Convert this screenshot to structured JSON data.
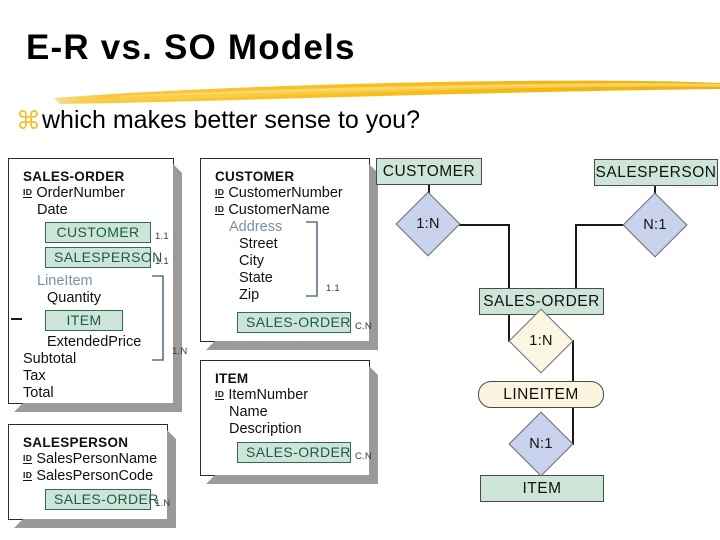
{
  "slide": {
    "title": "E-R vs. SO Models",
    "bullet_glyph": "⌘",
    "bullet_text": "which makes better sense to you?",
    "accent_color": "#F2C230",
    "object_box_fill": "#CDE5D8",
    "object_box_border": "#2F6B53",
    "diamond_fill": "#C8D2EC",
    "lineitem_fill": "#FBF5DF"
  },
  "so_model": {
    "cards": [
      {
        "name": "SALES-ORDER",
        "rows": [
          {
            "kind": "attr",
            "id": true,
            "label": "OrderNumber"
          },
          {
            "kind": "attr",
            "id": false,
            "label": "Date"
          },
          {
            "kind": "objbox",
            "label": "CUSTOMER",
            "cardinality": "1.1"
          },
          {
            "kind": "objbox",
            "label": "SALESPERSON",
            "cardinality": "1.1"
          },
          {
            "kind": "group",
            "label": "LineItem",
            "cardinality": "1.N"
          },
          {
            "kind": "attr",
            "id": false,
            "label": "Quantity"
          },
          {
            "kind": "objbox",
            "label": "ITEM",
            "cardinality": ""
          },
          {
            "kind": "attr",
            "id": false,
            "label": "ExtendedPrice"
          },
          {
            "kind": "attr",
            "id": false,
            "label": "Subtotal"
          },
          {
            "kind": "attr",
            "id": false,
            "label": "Tax"
          },
          {
            "kind": "attr",
            "id": false,
            "label": "Total"
          }
        ]
      },
      {
        "name": "SALESPERSON",
        "rows": [
          {
            "kind": "attr",
            "id": true,
            "label": "SalesPersonName"
          },
          {
            "kind": "attr",
            "id": true,
            "label": "SalesPersonCode"
          },
          {
            "kind": "objbox",
            "label": "SALES-ORDER",
            "cardinality": "1.N"
          }
        ]
      },
      {
        "name": "CUSTOMER",
        "rows": [
          {
            "kind": "attr",
            "id": true,
            "label": "CustomerNumber"
          },
          {
            "kind": "attr",
            "id": true,
            "label": "CustomerName"
          },
          {
            "kind": "group",
            "label": "Address",
            "cardinality": "1.1"
          },
          {
            "kind": "attr",
            "id": false,
            "label": "Street"
          },
          {
            "kind": "attr",
            "id": false,
            "label": "City"
          },
          {
            "kind": "attr",
            "id": false,
            "label": "State"
          },
          {
            "kind": "attr",
            "id": false,
            "label": "Zip"
          },
          {
            "kind": "objbox",
            "label": "SALES-ORDER",
            "cardinality": "C.N"
          }
        ]
      },
      {
        "name": "ITEM",
        "rows": [
          {
            "kind": "attr",
            "id": true,
            "label": "ItemNumber"
          },
          {
            "kind": "attr",
            "id": false,
            "label": "Name"
          },
          {
            "kind": "attr",
            "id": false,
            "label": "Description"
          },
          {
            "kind": "objbox",
            "label": "SALES-ORDER",
            "cardinality": "C.N"
          }
        ]
      }
    ],
    "labels": {
      "card_so_customer": "1.1",
      "card_so_salesperson": "1.1",
      "card_so_lineitem": "1.N",
      "card_sp_salesorder": "1.N",
      "card_cu_address": "1.1",
      "card_cu_salesorder": "C.N",
      "card_it_salesorder": "C.N",
      "so_title": "SALES-ORDER",
      "so_attr_ordernumber": "OrderNumber",
      "so_attr_date": "Date",
      "so_obj_customer": "CUSTOMER",
      "so_obj_salesperson": "SALESPERSON",
      "so_group_lineitem": "LineItem",
      "so_attr_quantity": "Quantity",
      "so_obj_item": "ITEM",
      "so_attr_extendedprice": "ExtendedPrice",
      "so_attr_subtotal": "Subtotal",
      "so_attr_tax": "Tax",
      "so_attr_total": "Total",
      "sp_title": "SALESPERSON",
      "sp_attr_name": "SalesPersonName",
      "sp_attr_code": "SalesPersonCode",
      "sp_obj_salesorder": "SALES-ORDER",
      "cu_title": "CUSTOMER",
      "cu_attr_number": "CustomerNumber",
      "cu_attr_name": "CustomerName",
      "cu_group_address": "Address",
      "cu_attr_street": "Street",
      "cu_attr_city": "City",
      "cu_attr_state": "State",
      "cu_attr_zip": "Zip",
      "cu_obj_salesorder": "SALES-ORDER",
      "it_title": "ITEM",
      "it_attr_number": "ItemNumber",
      "it_attr_name": "Name",
      "it_attr_description": "Description",
      "it_obj_salesorder": "SALES-ORDER",
      "id_mark": "ID"
    }
  },
  "er_model": {
    "entities": [
      {
        "label": "CUSTOMER"
      },
      {
        "label": "SALESPERSON"
      },
      {
        "label": "SALES-ORDER"
      },
      {
        "label": "LINEITEM"
      },
      {
        "label": "ITEM"
      }
    ],
    "relationships": [
      {
        "label": "1:N"
      },
      {
        "label": "N:1"
      },
      {
        "label": "1:N"
      },
      {
        "label": "N:1"
      }
    ],
    "entity_customer": "CUSTOMER",
    "entity_salesperson": "SALESPERSON",
    "entity_salesorder": "SALES-ORDER",
    "entity_lineitem": "LINEITEM",
    "entity_item": "ITEM",
    "rel_cust_so": "1:N",
    "rel_sp_so": "N:1",
    "rel_so_li": "1:N",
    "rel_li_item": "N:1"
  }
}
